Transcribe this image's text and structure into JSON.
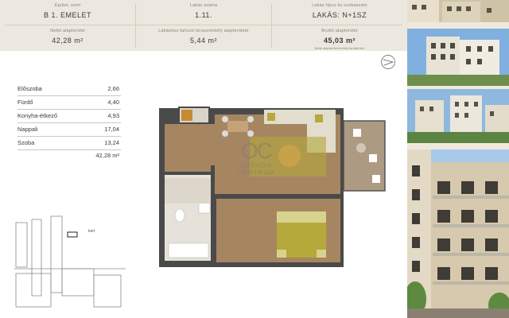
{
  "header": {
    "cells": [
      {
        "label": "Épület, szint",
        "value": "B 1. EMELET"
      },
      {
        "label": "Lakás száma",
        "value": "1.11."
      },
      {
        "label": "Lakás típus és szobaszám",
        "value": "LAKÁS: N+1SZ"
      },
      {
        "label": "Nettó alapterület",
        "value": "42,28 m²"
      },
      {
        "label": "Lakáshoz tartozó terasz/erkély alapterülete",
        "value": "5,44 m²"
      },
      {
        "label": "Bruttó alapterület",
        "value": "45,03 m²",
        "note": "Nettó alapterület+erkély területi fele"
      }
    ]
  },
  "rooms": [
    {
      "name": "Előszoba",
      "area": "2,66"
    },
    {
      "name": "Fürdő",
      "area": "4,40"
    },
    {
      "name": "Konyha-étkező",
      "area": "4,93"
    },
    {
      "name": "Nappali",
      "area": "17,04"
    },
    {
      "name": "Szoba",
      "area": "13,24"
    }
  ],
  "total_area": "42,28 m²",
  "watermark": {
    "logo": "OC",
    "line1": "OTTHON",
    "line2": "CENTRUM"
  },
  "siteplan": {
    "label": "kert"
  },
  "colors": {
    "header_bg": "#ece8df",
    "wall": "#4a4a4a",
    "wood_floor": "#a68661",
    "tile": "#e6e2da",
    "terrace": "#ad9a82",
    "accent_olive": "#b4a93a"
  }
}
